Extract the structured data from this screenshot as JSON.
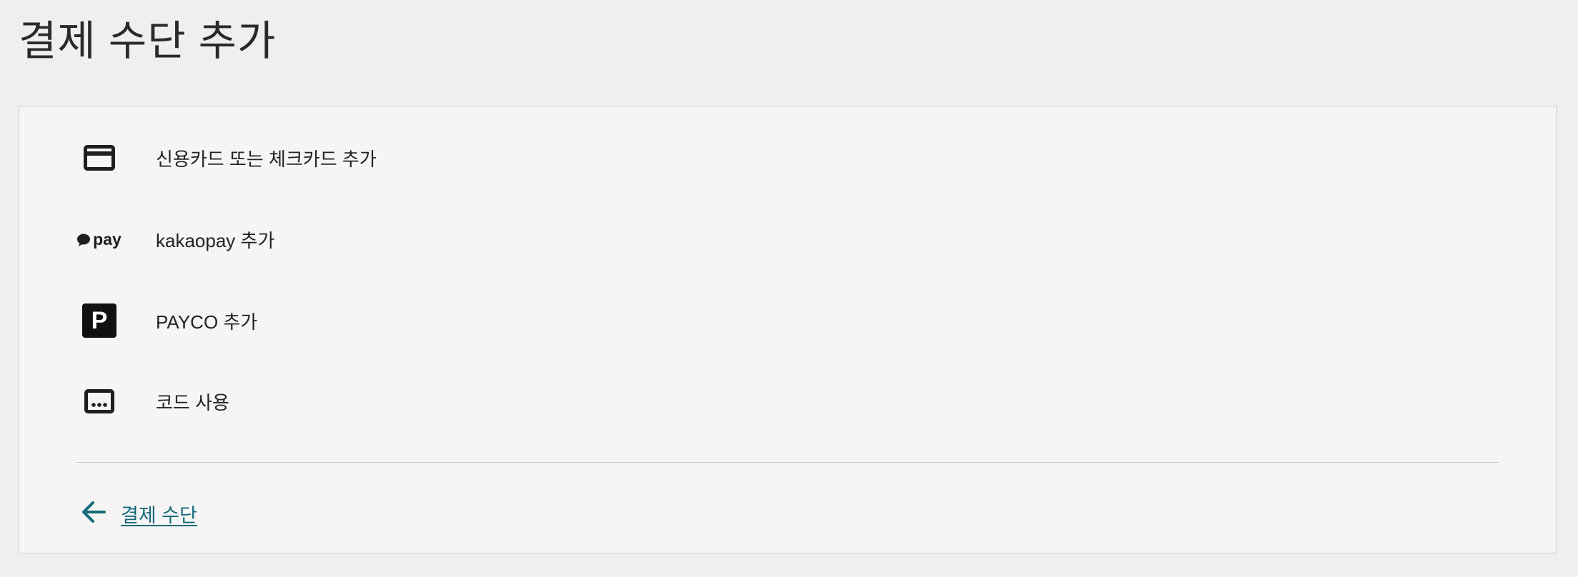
{
  "page": {
    "title": "결제 수단 추가"
  },
  "options": [
    {
      "label": "신용카드 또는 체크카드 추가",
      "icon": "credit-card-icon"
    },
    {
      "label": "kakaopay 추가",
      "icon": "kakaopay-icon",
      "icon_text": "pay"
    },
    {
      "label": "PAYCO 추가",
      "icon": "payco-icon",
      "icon_text": "P"
    },
    {
      "label": "코드 사용",
      "icon": "redeem-code-icon"
    }
  ],
  "back_link": {
    "label": "결제 수단",
    "icon": "arrow-left-icon"
  },
  "colors": {
    "background": "#efefef",
    "panel": "#f5f5f5",
    "link": "#166a7a",
    "icon": "#1e1e1e"
  }
}
